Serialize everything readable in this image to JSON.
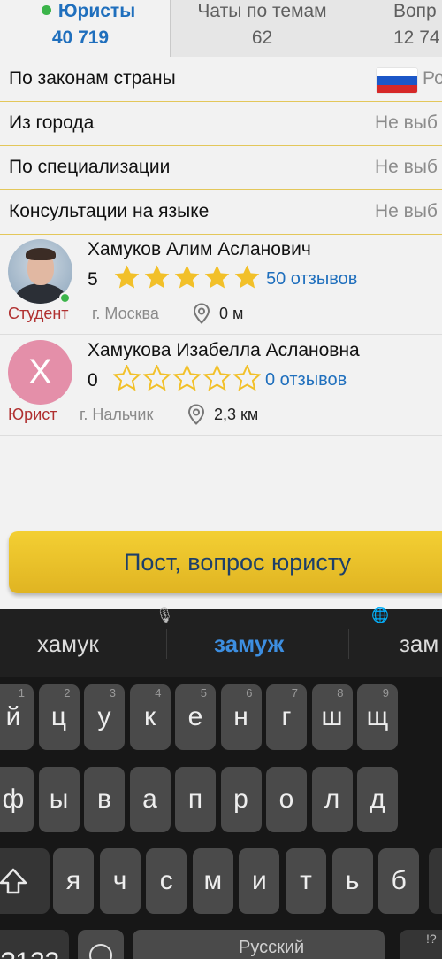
{
  "tabs": [
    {
      "label": "Юристы",
      "count": "40 719",
      "active": true
    },
    {
      "label": "Чаты по темам",
      "count": "62",
      "active": false
    },
    {
      "label": "Вопр",
      "count": "12 74",
      "active": false
    }
  ],
  "filters": [
    {
      "label": "По законам страны",
      "value": "Ро"
    },
    {
      "label": "Из города",
      "value": "Не выб"
    },
    {
      "label": "По специализации",
      "value": "Не выб"
    },
    {
      "label": "Консультации на языке",
      "value": "Не выб"
    }
  ],
  "flag_colors": [
    "#ffffff",
    "#1c57c8",
    "#d62828"
  ],
  "lawyers": [
    {
      "name": "Хамуков Алим Асланович",
      "rating": "5",
      "stars": 5,
      "reviews": "50 отзывов",
      "role": "Студент",
      "city": "г. Москва",
      "distance": "0 м",
      "online": true,
      "avatar": "photo"
    },
    {
      "name": "Хамукова Изабелла Аслановна",
      "rating": "0",
      "stars": 0,
      "reviews": "0 отзывов",
      "role": "Юрист",
      "city": "г. Нальчик",
      "distance": "2,3 км",
      "online": false,
      "avatar": "letter",
      "avatar_letter": "Х"
    }
  ],
  "post_button": "Пост, вопрос юристу",
  "keyboard": {
    "suggestions": [
      "хамук",
      "замуж",
      "зам"
    ],
    "row1": [
      {
        "k": "й",
        "h": "1"
      },
      {
        "k": "ц",
        "h": "2"
      },
      {
        "k": "у",
        "h": "3"
      },
      {
        "k": "к",
        "h": "4"
      },
      {
        "k": "е",
        "h": "5"
      },
      {
        "k": "н",
        "h": "6"
      },
      {
        "k": "г",
        "h": "7"
      },
      {
        "k": "ш",
        "h": "8"
      },
      {
        "k": "щ",
        "h": "9"
      }
    ],
    "row2": [
      "ф",
      "ы",
      "в",
      "а",
      "п",
      "р",
      "о",
      "л",
      "д"
    ],
    "row3": [
      "я",
      "ч",
      "с",
      "м",
      "и",
      "т",
      "ь",
      "б"
    ],
    "bottom": {
      "symbols": "?123",
      "space": "Русский",
      "punct": "!?"
    }
  },
  "colors": {
    "accent": "#1f6fbd",
    "online": "#3bb44a",
    "star": "#f2c029",
    "button": "#f0c82c",
    "role": "#b03030"
  }
}
